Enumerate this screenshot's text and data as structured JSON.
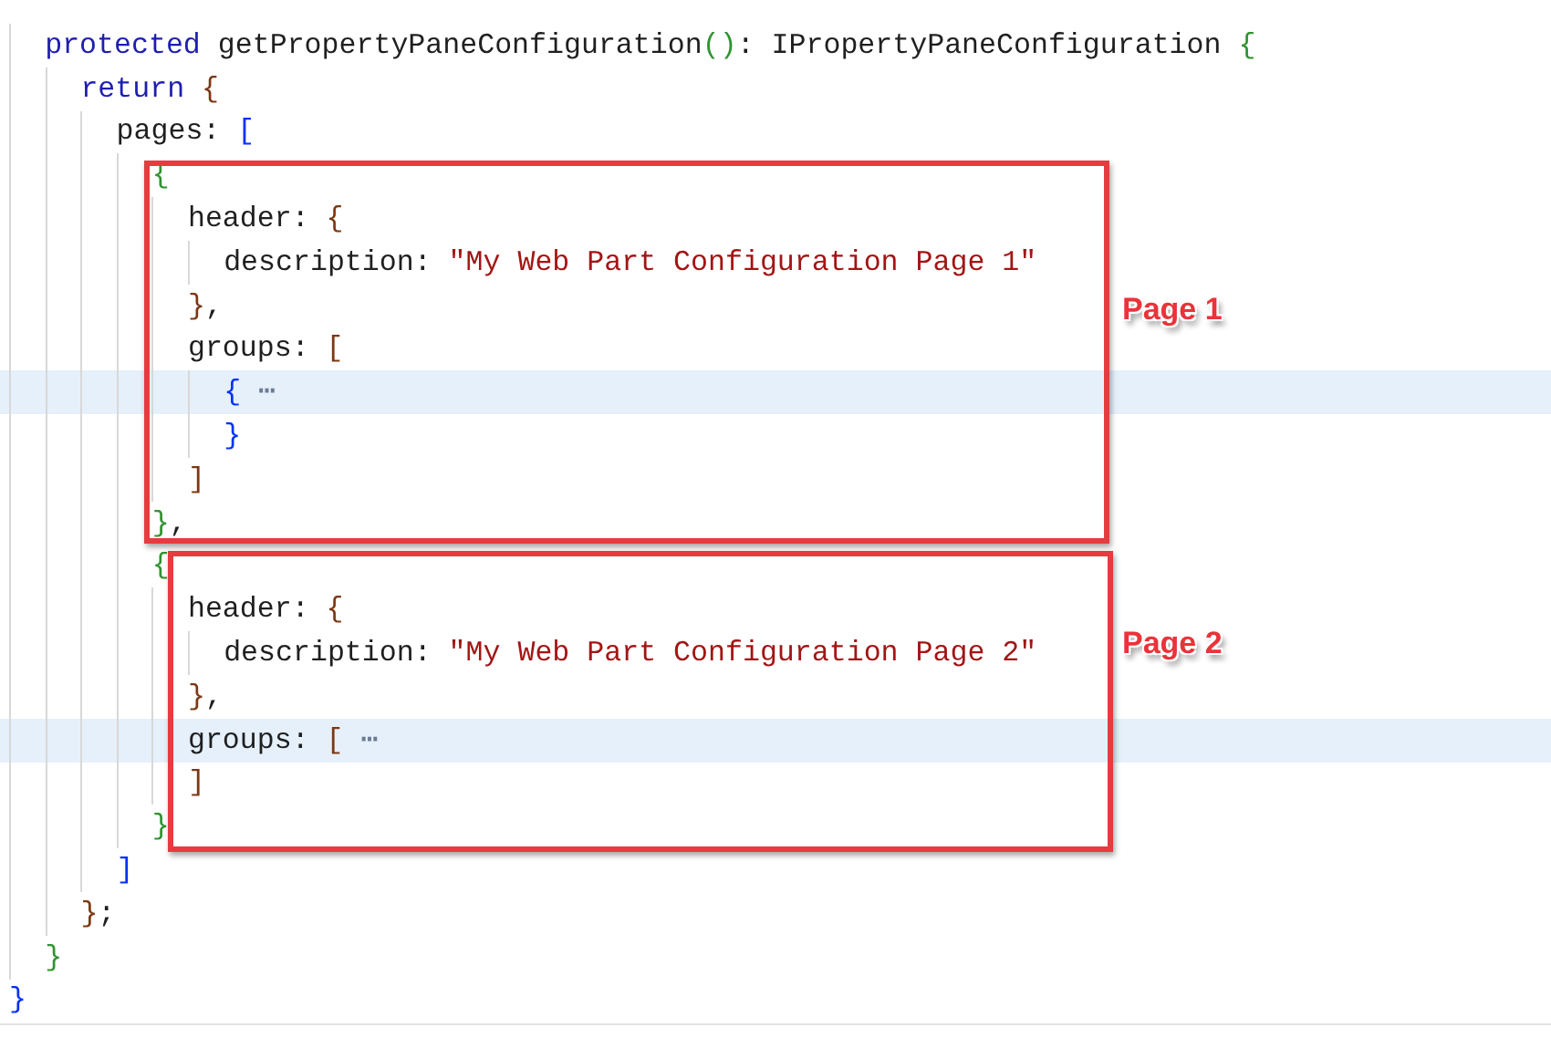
{
  "editor": {
    "lines": [
      {
        "children": [
          {
            "tokens": [
              {
                "kind": "keyword",
                "text": "protected"
              },
              {
                "kind": "plain",
                "text": " getPropertyPaneConfiguration"
              },
              {
                "kind": "bracket",
                "text": "()",
                "color": "#319331"
              },
              {
                "kind": "plain",
                "text": ": IPropertyPaneConfiguration"
              },
              {
                "kind": "bracket",
                "text": " {",
                "color": "#319331"
              }
            ],
            "children": [
              {
                "tokens": [
                  {
                    "kind": "keyword",
                    "text": "return"
                  },
                  {
                    "kind": "bracket",
                    "text": " {",
                    "color": "#7b3814"
                  }
                ],
                "children": [
                  {
                    "tokens": [
                      {
                        "kind": "plain",
                        "text": "pages:"
                      },
                      {
                        "kind": "bracket",
                        "text": " [",
                        "color": "#0431fa"
                      }
                    ],
                    "children": [
                      {
                        "tokens": [
                          {
                            "kind": "bracket",
                            "text": "{",
                            "color": "#319331"
                          }
                        ],
                        "children": [
                          {
                            "tokens": [
                              {
                                "kind": "plain",
                                "text": "header:"
                              },
                              {
                                "kind": "bracket",
                                "text": " {",
                                "color": "#7b3814"
                              }
                            ],
                            "children": [
                              {
                                "tokens": [
                                  {
                                    "kind": "plain",
                                    "text": "description:"
                                  },
                                  {
                                    "kind": "string",
                                    "text": " \"My Web Part Configuration Page 1\""
                                  }
                                ]
                              }
                            ]
                          },
                          {
                            "tokens": [
                              {
                                "kind": "bracket",
                                "text": "}",
                                "color": "#7b3814"
                              },
                              {
                                "kind": "plain",
                                "text": ","
                              }
                            ]
                          },
                          {
                            "tokens": [
                              {
                                "kind": "plain",
                                "text": "groups:"
                              },
                              {
                                "kind": "bracket",
                                "text": " [",
                                "color": "#7b3814"
                              }
                            ],
                            "children": [
                              {
                                "highlighted": true,
                                "tokens": [
                                  {
                                    "kind": "bracket",
                                    "text": "{",
                                    "color": "#0431fa"
                                  },
                                  {
                                    "kind": "fold",
                                    "text": " ⋯"
                                  }
                                ]
                              },
                              {
                                "tokens": [
                                  {
                                    "kind": "bracket",
                                    "text": "}",
                                    "color": "#0431fa"
                                  }
                                ]
                              }
                            ]
                          },
                          {
                            "tokens": [
                              {
                                "kind": "bracket",
                                "text": "]",
                                "color": "#7b3814"
                              }
                            ]
                          }
                        ]
                      },
                      {
                        "tokens": [
                          {
                            "kind": "bracket",
                            "text": "}",
                            "color": "#319331"
                          },
                          {
                            "kind": "plain",
                            "text": ","
                          }
                        ]
                      },
                      {
                        "tokens": [
                          {
                            "kind": "bracket",
                            "text": "{",
                            "color": "#319331"
                          }
                        ],
                        "children": [
                          {
                            "tokens": [
                              {
                                "kind": "plain",
                                "text": "header:"
                              },
                              {
                                "kind": "bracket",
                                "text": " {",
                                "color": "#7b3814"
                              }
                            ],
                            "children": [
                              {
                                "tokens": [
                                  {
                                    "kind": "plain",
                                    "text": "description:"
                                  },
                                  {
                                    "kind": "string",
                                    "text": " \"My Web Part Configuration Page 2\""
                                  }
                                ]
                              }
                            ]
                          },
                          {
                            "tokens": [
                              {
                                "kind": "bracket",
                                "text": "}",
                                "color": "#7b3814"
                              },
                              {
                                "kind": "plain",
                                "text": ","
                              }
                            ]
                          },
                          {
                            "highlighted": true,
                            "tokens": [
                              {
                                "kind": "plain",
                                "text": "groups:"
                              },
                              {
                                "kind": "bracket",
                                "text": " [",
                                "color": "#7b3814"
                              },
                              {
                                "kind": "fold",
                                "text": " ⋯"
                              }
                            ]
                          },
                          {
                            "tokens": [
                              {
                                "kind": "bracket",
                                "text": "]",
                                "color": "#7b3814"
                              }
                            ]
                          }
                        ]
                      },
                      {
                        "tokens": [
                          {
                            "kind": "bracket",
                            "text": "}",
                            "color": "#319331"
                          }
                        ]
                      }
                    ]
                  },
                  {
                    "tokens": [
                      {
                        "kind": "bracket",
                        "text": "]",
                        "color": "#0431fa"
                      }
                    ]
                  }
                ]
              },
              {
                "tokens": [
                  {
                    "kind": "bracket",
                    "text": "}",
                    "color": "#7b3814"
                  },
                  {
                    "kind": "plain",
                    "text": ";"
                  }
                ]
              }
            ]
          },
          {
            "tokens": [
              {
                "kind": "bracket",
                "text": "}",
                "color": "#319331"
              }
            ]
          }
        ]
      },
      {
        "tokens": [
          {
            "kind": "bracket",
            "text": "}",
            "color": "#0431fa"
          }
        ]
      }
    ]
  },
  "annotations": [
    {
      "label": "Page 1"
    },
    {
      "label": "Page 2"
    }
  ]
}
